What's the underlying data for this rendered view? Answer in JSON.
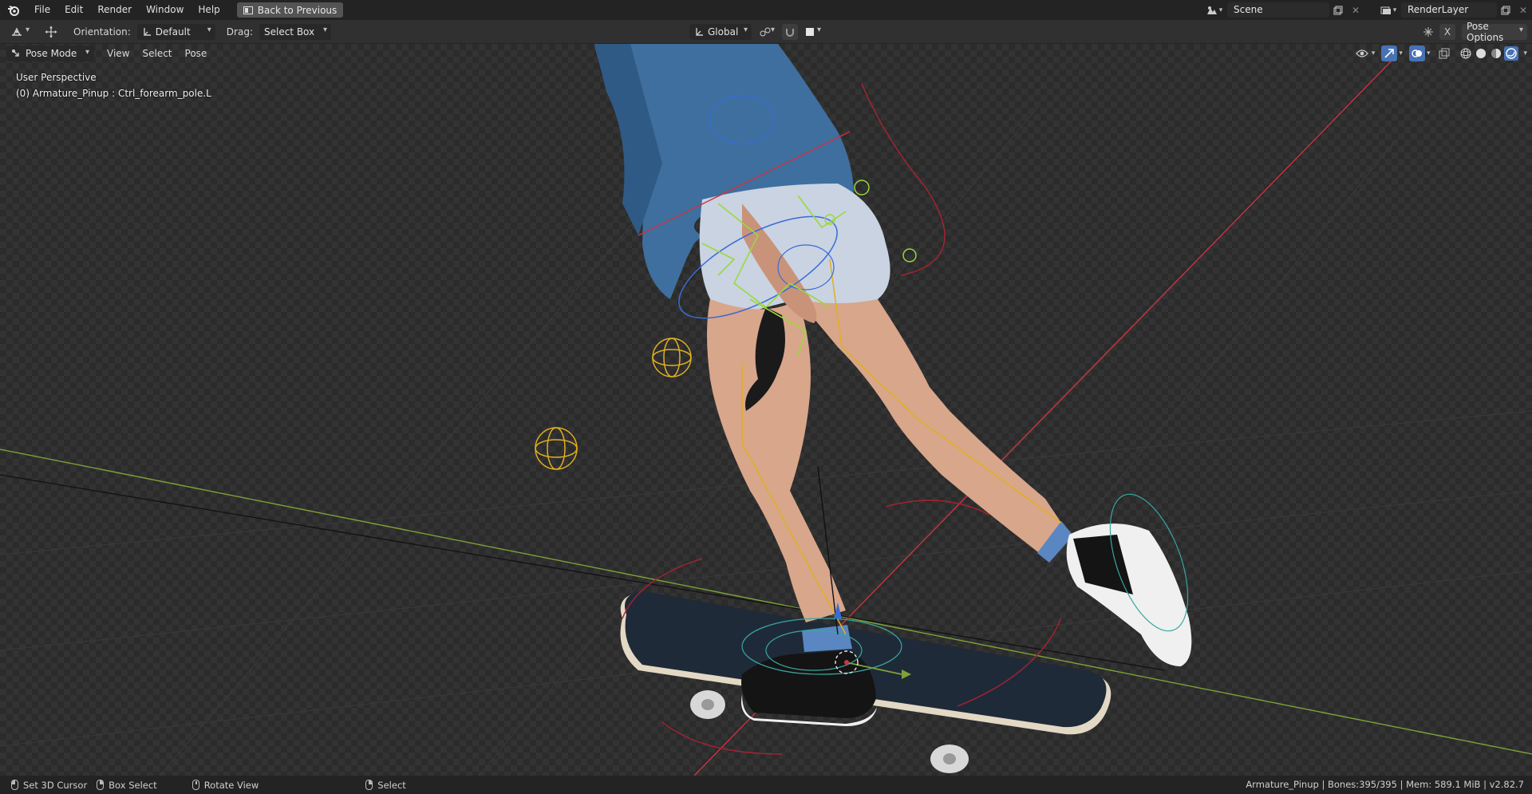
{
  "menu": {
    "items": [
      "File",
      "Edit",
      "Render",
      "Window",
      "Help"
    ],
    "back_button": "Back to Previous"
  },
  "scene": {
    "name": "Scene",
    "render_layer": "RenderLayer"
  },
  "header": {
    "orientation_label": "Orientation:",
    "orientation_value": "Default",
    "drag_label": "Drag:",
    "drag_value": "Select Box",
    "transform_orientation": "Global",
    "pose_options": "Pose Options",
    "x_mirror": "X"
  },
  "viewport": {
    "mode": "Pose Mode",
    "menus": [
      "View",
      "Select",
      "Pose"
    ],
    "perspective": "User Perspective",
    "active_object": "(0) Armature_Pinup : Ctrl_forearm_pole.L"
  },
  "statusbar": {
    "hints": [
      "Set 3D Cursor",
      "Box Select",
      "Rotate View",
      "Select"
    ],
    "info": "Armature_Pinup | Bones:395/395 | Mem: 589.1 MiB | v2.82.7"
  },
  "colors": {
    "accent": "#4772b3",
    "grid_x_axis": "#cc3344",
    "grid_y_axis": "#7ea238",
    "bone_selected": "#9ad93a",
    "bone_yellow": "#e0b020",
    "bone_blue": "#3a6bd6"
  }
}
